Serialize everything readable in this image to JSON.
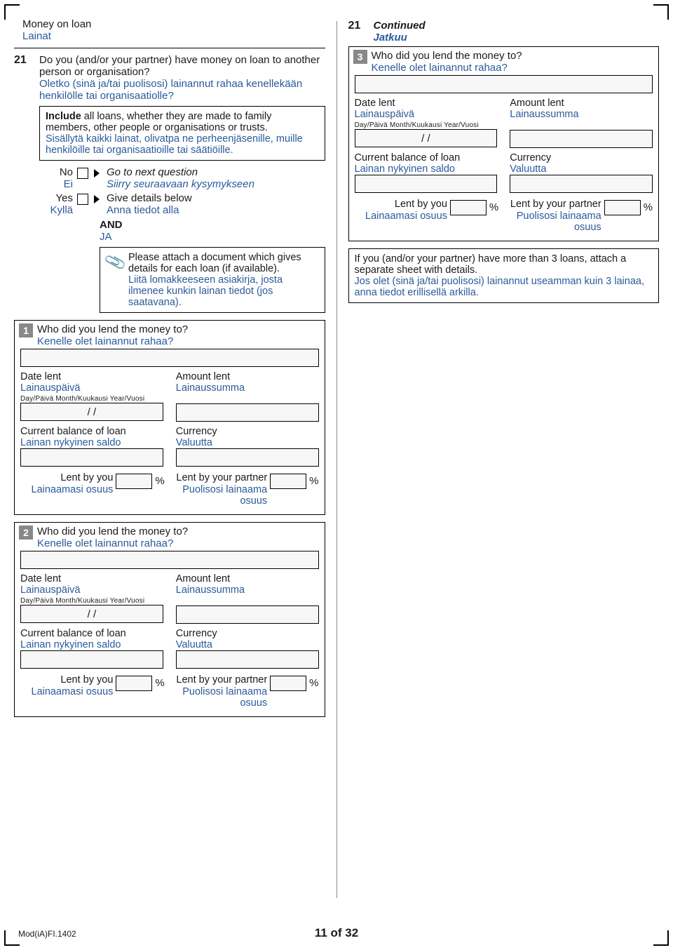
{
  "section": {
    "title_en": "Money on loan",
    "title_fi": "Lainat"
  },
  "q21": {
    "num": "21",
    "text_en": "Do you (and/or your partner) have money on loan to another person or organisation?",
    "text_fi": "Oletko (sinä ja/tai puolisosi) lainannut rahaa kenellekään henkilölle tai organisaatiolle?",
    "include_en": "Include",
    "include_en_rest": " all loans, whether they are made to family members, other people or organisations or trusts.",
    "include_fi": "Sisällytä",
    "include_fi_rest": " kaikki lainat, olivatpa ne perheenjäsenille, muille henkilöille tai organisaatioille tai säätiöille.",
    "no_en": "No",
    "no_fi": "Ei",
    "no_action_en": "Go to next question",
    "no_action_fi": "Siirry seuraavaan kysymykseen",
    "yes_en": "Yes",
    "yes_fi": "Kyllä",
    "yes_action_en": "Give details below",
    "yes_action_fi": "Anna tiedot alla",
    "and_en": "AND",
    "and_fi": "JA",
    "attach_en": "Please attach a document which gives details for each loan (if available).",
    "attach_fi": "Liitä lomakkeeseen asiakirja, josta ilmenee kunkin lainan tiedot (jos saatavana)."
  },
  "loan_labels": {
    "who_en": "Who did you lend the money to?",
    "who_fi": "Kenelle olet lainannut rahaa?",
    "date_en": "Date lent",
    "date_fi": "Lainauspäivä",
    "date_hdr": "Day/Päivä   Month/Kuukausi   Year/Vuosi",
    "slash": "/             /",
    "amount_en": "Amount lent",
    "amount_fi": "Lainaussumma",
    "balance_en": "Current balance of loan",
    "balance_fi": "Lainan nykyinen saldo",
    "currency_en": "Currency",
    "currency_fi": "Valuutta",
    "you_en": "Lent by you",
    "you_fi": "Lainaamasi osuus",
    "partner_en": "Lent by your partner",
    "partner_fi": "Puolisosi lainaama osuus",
    "pct": "%"
  },
  "right": {
    "num": "21",
    "continued_en": "Continued",
    "continued_fi": "Jatkuu",
    "note_en": "If you (and/or your partner) have more than 3 loans, attach a separate sheet with details.",
    "note_fi": "Jos olet (sinä ja/tai puolisosi) lainannut useamman kuin 3 lainaa, anna tiedot erillisellä arkilla."
  },
  "nums": {
    "n1": "1",
    "n2": "2",
    "n3": "3"
  },
  "footer": {
    "code": "Mod(iA)FI.1402",
    "page": "11 of 32"
  }
}
